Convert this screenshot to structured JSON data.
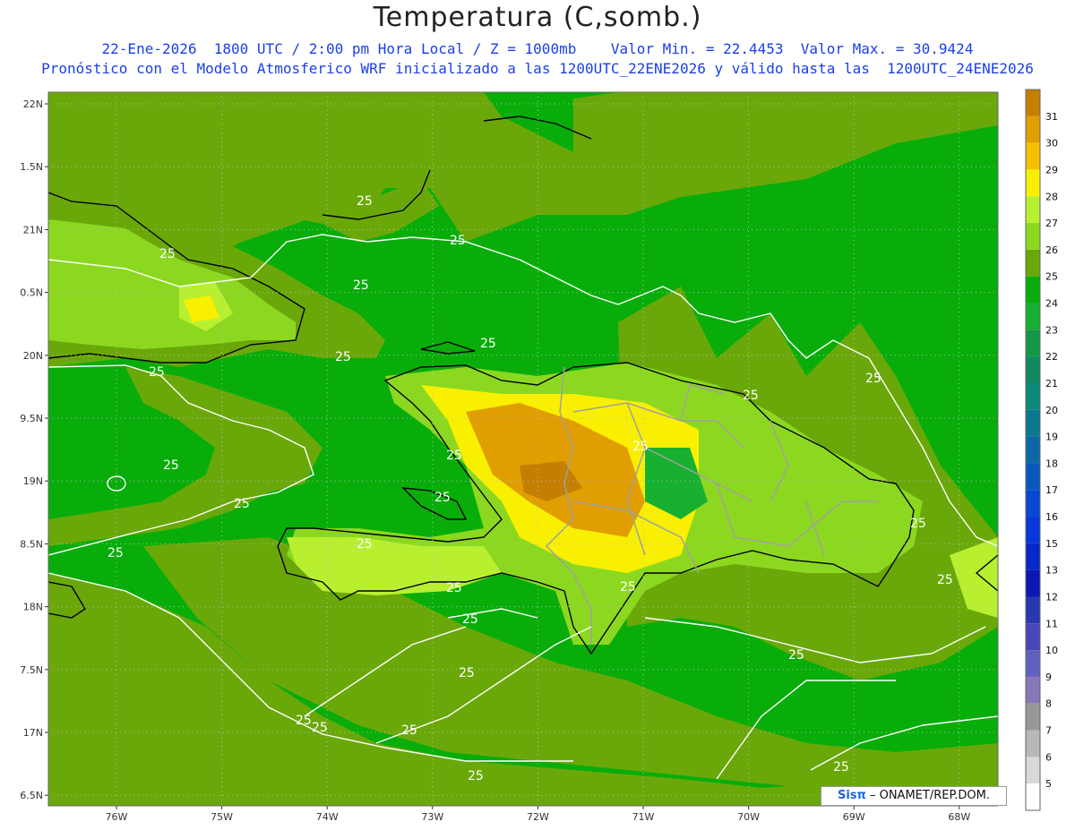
{
  "title": "Temperatura (C,somb.)",
  "subtitle1": "22-Ene-2026  1800 UTC / 2:00 pm Hora Local / Z = 1000mb    Valor Min. = 22.4453  Valor Max. = 30.9424",
  "subtitle2": "Pronóstico con el Modelo Atmosferico WRF inicializado a las 1200UTC_22ENE2026 y válido hasta las  1200UTC_24ENE2026",
  "credit": {
    "logo": "Sisπ",
    "text": "– ONAMET/REP.DOM."
  },
  "map": {
    "lat_labels": [
      "22N",
      "1.5N",
      "21N",
      "0.5N",
      "20N",
      "9.5N",
      "19N",
      "8.5N",
      "18N",
      "7.5N",
      "17N",
      "6.5N"
    ],
    "lon_labels": [
      "76W",
      "75W",
      "74W",
      "73W",
      "72W",
      "71W",
      "70W",
      "69W",
      "68W"
    ],
    "contour_value": "25",
    "colors": {
      "ocean": "#08ad0a",
      "land_warm": "#6aa80a",
      "coast": "#000000",
      "borders": "#a0a0a0",
      "contour": "#ffffff"
    }
  },
  "colorbar": {
    "labels": [
      "31",
      "30",
      "29",
      "28",
      "27",
      "26",
      "25",
      "24",
      "23",
      "22",
      "21",
      "20",
      "19",
      "18",
      "17",
      "16",
      "15",
      "13",
      "12",
      "11",
      "10",
      "9",
      "8",
      "7",
      "6",
      "5"
    ],
    "colors": [
      "#c47e00",
      "#e09e00",
      "#f5c000",
      "#f8f000",
      "#b8f030",
      "#8cd820",
      "#6aa80a",
      "#08ad0a",
      "#18b030",
      "#149848",
      "#108860",
      "#0c8878",
      "#0c7890",
      "#0a68a8",
      "#0858c0",
      "#0648d0",
      "#0638d8",
      "#0628c8",
      "#0818b0",
      "#2838b0",
      "#4848b8",
      "#6060c0",
      "#8878b8",
      "#989898",
      "#b8b8b8",
      "#d8d8d8",
      "#ffffff"
    ]
  }
}
